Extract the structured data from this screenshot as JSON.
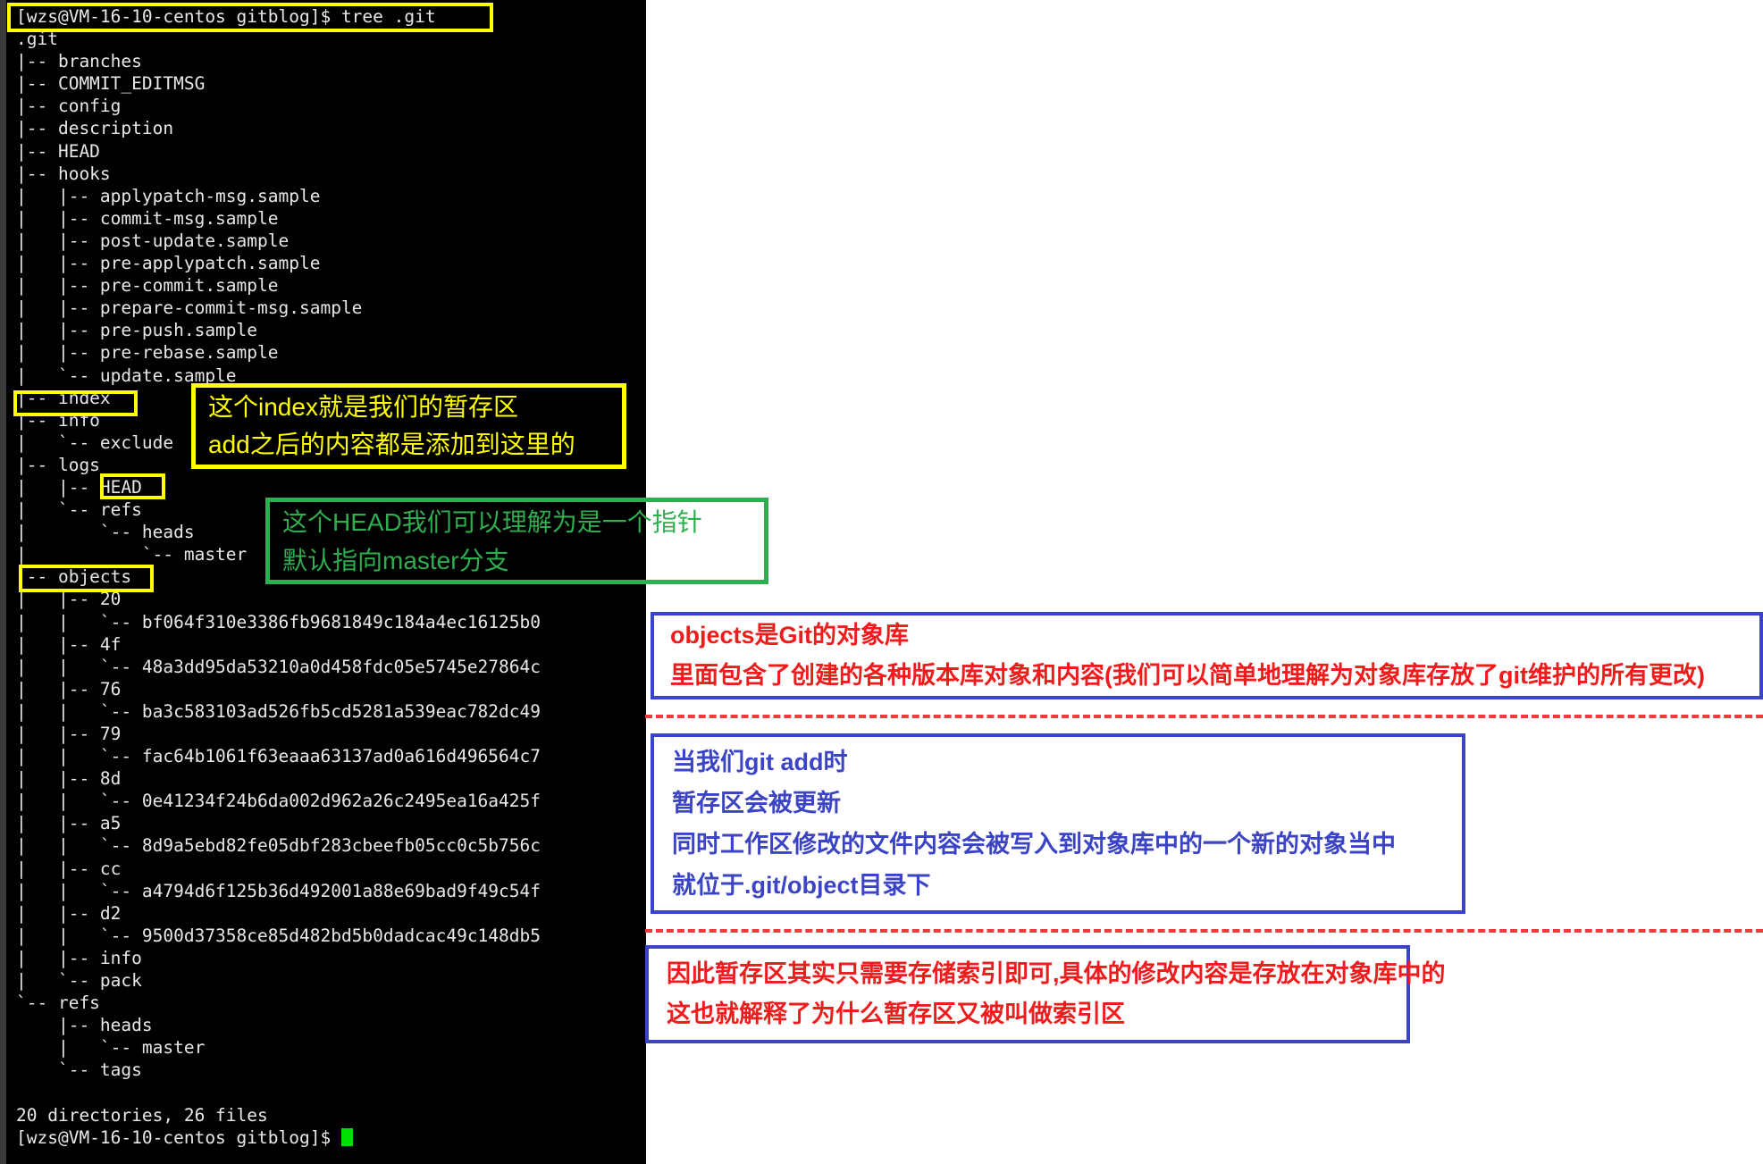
{
  "terminal": {
    "prompt_command": "[wzs@VM-16-10-centos gitblog]$ tree .git",
    "tree_lines": [
      ".git",
      "|-- branches",
      "|-- COMMIT_EDITMSG",
      "|-- config",
      "|-- description",
      "|-- HEAD",
      "|-- hooks",
      "|   |-- applypatch-msg.sample",
      "|   |-- commit-msg.sample",
      "|   |-- post-update.sample",
      "|   |-- pre-applypatch.sample",
      "|   |-- pre-commit.sample",
      "|   |-- prepare-commit-msg.sample",
      "|   |-- pre-push.sample",
      "|   |-- pre-rebase.sample",
      "|   `-- update.sample",
      "|-- index",
      "|-- info",
      "|   `-- exclude",
      "|-- logs",
      "|   |-- HEAD",
      "|   `-- refs",
      "|       `-- heads",
      "|           `-- master",
      "|-- objects",
      "|   |-- 20",
      "|   |   `-- bf064f310e3386fb9681849c184a4ec16125b0",
      "|   |-- 4f",
      "|   |   `-- 48a3dd95da53210a0d458fdc05e5745e27864c",
      "|   |-- 76",
      "|   |   `-- ba3c583103ad526fb5cd5281a539eac782dc49",
      "|   |-- 79",
      "|   |   `-- fac64b1061f63eaaa63137ad0a616d496564c7",
      "|   |-- 8d",
      "|   |   `-- 0e41234f24b6da002d962a26c2495ea16a425f",
      "|   |-- a5",
      "|   |   `-- 8d9a5ebd82fe05dbf283cbeefb05cc0c5b756c",
      "|   |-- cc",
      "|   |   `-- a4794d6f125b36d492001a88e69bad9f49c54f",
      "|   |-- d2",
      "|   |   `-- 9500d37358ce85d482bd5b0dadcac49c148db5",
      "|   |-- info",
      "|   `-- pack",
      "`-- refs",
      "    |-- heads",
      "    |   `-- master",
      "    `-- tags",
      "",
      "20 directories, 26 files"
    ],
    "summary": "20 directories, 26 files",
    "prompt_final": "[wzs@VM-16-10-centos gitblog]$ "
  },
  "highlights": {
    "command": "[wzs@VM-16-10-centos gitblog]$ tree .git",
    "index": "index",
    "logs_head": "HEAD",
    "objects": "objects"
  },
  "annotations": {
    "index_note": {
      "color": "#ffff00",
      "lines": [
        "这个index就是我们的暂存区",
        "add之后的内容都是添加到这里的"
      ]
    },
    "head_note": {
      "color": "#2eae4e",
      "lines": [
        "这个HEAD我们可以理解为是一个指针",
        "默认指向master分支"
      ]
    },
    "objects_note": {
      "border_color": "#3b44c4",
      "text_color": "#ee1c1c",
      "lines": [
        "objects是Git的对象库",
        "里面包含了创建的各种版本库对象和内容(我们可以简单地理解为对象库存放了git维护的所有更改)"
      ]
    },
    "git_add_note": {
      "border_color": "#3b44c4",
      "text_color": "#3b44c4",
      "lines": [
        "当我们git add时",
        "暂存区会被更新",
        "同时工作区修改的文件内容会被写入到对象库中的一个新的对象当中",
        "就位于.git/object目录下"
      ]
    },
    "index_area_note": {
      "border_color": "#3b44c4",
      "text_color": "#ee1c1c",
      "lines": [
        "因此暂存区其实只需要存储索引即可,具体的修改内容是存放在对象库中的",
        "这也就解释了为什么暂存区又被叫做索引区"
      ]
    }
  },
  "colors": {
    "terminal_bg": "#000000",
    "terminal_fg": "#e8e8e8",
    "highlight_yellow": "#ffff00",
    "annotation_green": "#2eae4e",
    "annotation_blue": "#3b44c4",
    "annotation_red": "#ee1c1c",
    "dashed_red": "#ef3b3b",
    "cursor_green": "#00e000"
  }
}
